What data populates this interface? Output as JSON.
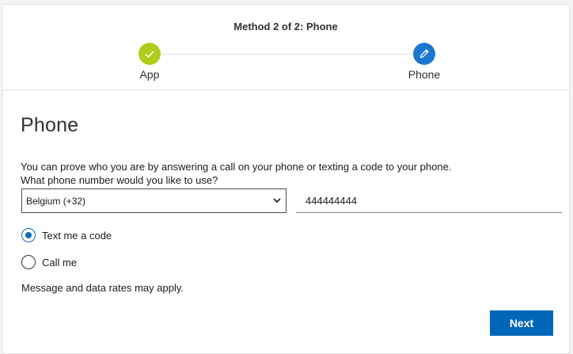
{
  "header": {
    "method_title": "Method 2 of 2: Phone",
    "steps": [
      {
        "label": "App",
        "status": "complete",
        "icon": "checkmark-icon",
        "color": "#b2cc1a"
      },
      {
        "label": "Phone",
        "status": "current",
        "icon": "pencil-icon",
        "color": "#1b76d2"
      }
    ]
  },
  "main": {
    "title": "Phone",
    "description_line1": "You can prove who you are by answering a call on your phone or texting a code to your phone.",
    "description_line2": "What phone number would you like to use?",
    "country_select": {
      "selected": "Belgium (+32)"
    },
    "phone_input": {
      "value": "444444444"
    },
    "options": [
      {
        "label": "Text me a code",
        "checked": true
      },
      {
        "label": "Call me",
        "checked": false
      }
    ],
    "rates_note": "Message and data rates may apply.",
    "next_label": "Next"
  },
  "colors": {
    "accent": "#0067b8",
    "radio_selected": "#0f6cbd"
  }
}
